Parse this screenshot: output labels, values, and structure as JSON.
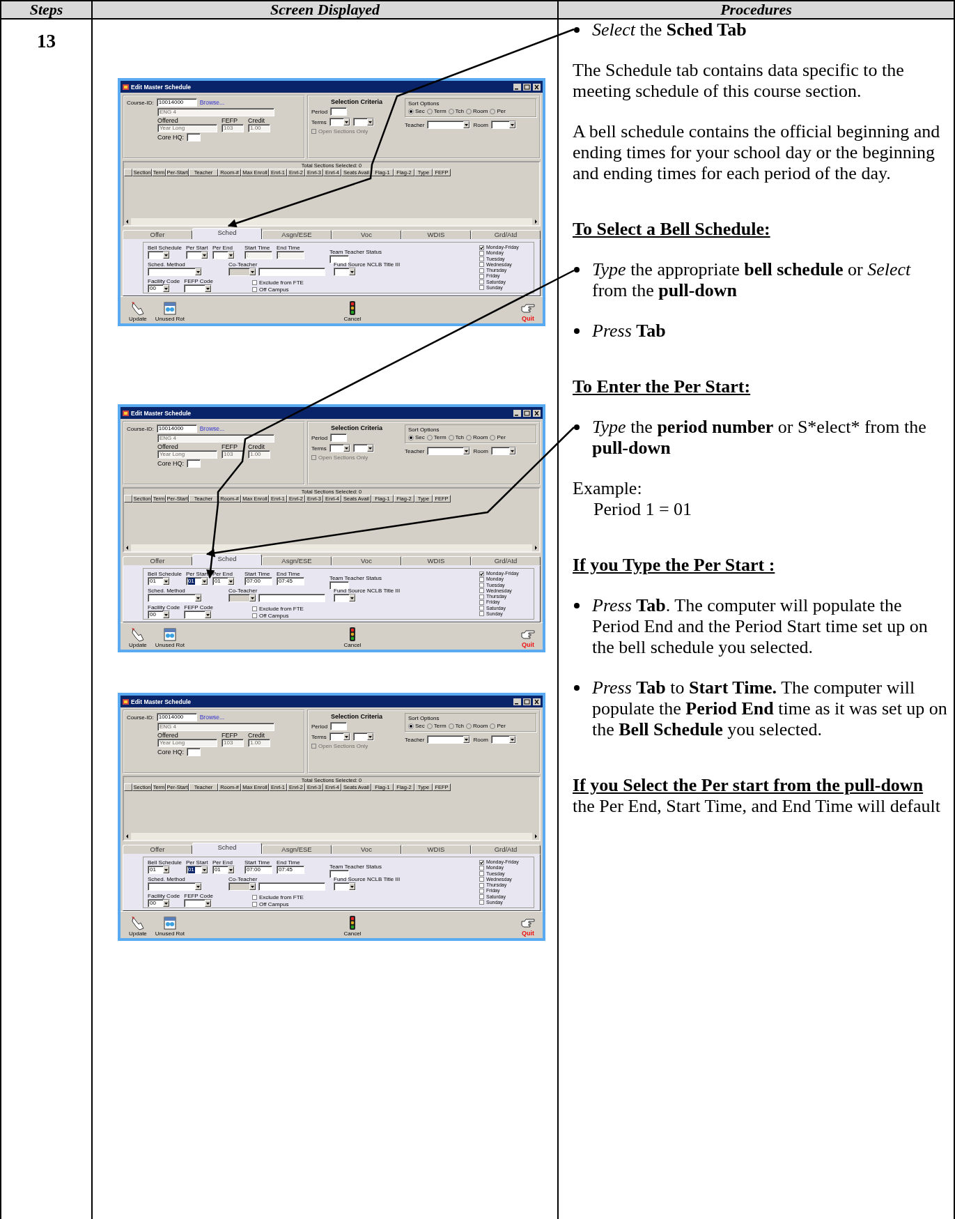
{
  "table": {
    "columns": [
      "Steps",
      "Screen Displayed",
      "Procedures"
    ],
    "step": "13",
    "screens": [
      {
        "title": "Edit Master Schedule",
        "course": {
          "id": {
            "label": "Course-ID:",
            "value": "10014000"
          },
          "browse": "Browse...",
          "name": {
            "value": "ENG 4",
            "disabled": true
          },
          "offered": {
            "label": "Offered",
            "value": "Year Long",
            "disabled": true
          },
          "fefp": {
            "label": "FEFP",
            "value": "103",
            "disabled": true
          },
          "credit": {
            "label": "Credit",
            "value": "1.00",
            "disabled": true
          },
          "core_hq": {
            "label": "Core HQ:"
          }
        },
        "criteria": {
          "title": "Selection Criteria",
          "period_label": "Period",
          "terms_label": "Terms",
          "open_sections": {
            "label": "Open Sections Only",
            "checked": false,
            "disabled": true
          },
          "sort_title": "Sort Options",
          "sort_options": [
            {
              "label": "Sec",
              "selected": true
            },
            {
              "label": "Term",
              "selected": false
            },
            {
              "label": "Tch",
              "selected": false
            },
            {
              "label": "Room",
              "selected": false
            },
            {
              "label": "Per",
              "selected": false
            }
          ],
          "teacher_label": "Teacher",
          "room_label": "Room"
        },
        "grid": {
          "summary": "Total Sections Selected: 0",
          "columns": [
            "Section",
            "Term",
            "Per-Start",
            "Teacher",
            "Room-#",
            "Max Enroll",
            "Enrl-1",
            "Enrl-2",
            "Enrl-3",
            "Enrl-4",
            "Seats Avail",
            "Flag-1",
            "Flag-2",
            "Type",
            "FEFP"
          ]
        },
        "tabs": [
          {
            "label": "Offer",
            "selected": false
          },
          {
            "label": "Sched",
            "selected": true
          },
          {
            "label": "Asgn/ESE",
            "selected": false
          },
          {
            "label": "Voc",
            "selected": false
          },
          {
            "label": "WDIS",
            "selected": false
          },
          {
            "label": "Grd/Atd",
            "selected": false
          }
        ],
        "sched": {
          "bell_schedule": {
            "label": "Bell Schedule"
          },
          "per_start": {
            "label": "Per Start",
            "highlighted": false
          },
          "per_end": {
            "label": "Per End"
          },
          "start_time": {
            "label": "Start Time",
            "value": ":",
            "disabled": true
          },
          "end_time": {
            "label": "End Time",
            "value": ":",
            "disabled": true
          },
          "team_teacher_status": {
            "label": "Team Teacher Status"
          },
          "sched_method": {
            "label": "Sched. Method"
          },
          "co_teacher": {
            "label": "Co-Teacher"
          },
          "fund_source": {
            "label": "Fund Source NCLB Title III"
          },
          "facility_code": {
            "label": "Facility Code",
            "value": "00"
          },
          "fefp_code": {
            "label": "FEFP Code"
          },
          "options": [
            {
              "label": "Exclude from FTE",
              "checked": false
            },
            {
              "label": "Off Campus",
              "checked": false
            }
          ],
          "days": [
            {
              "label": "Monday-Friday",
              "checked": true
            },
            {
              "label": "Monday",
              "checked": false
            },
            {
              "label": "Tuesday",
              "checked": false
            },
            {
              "label": "Wednesday",
              "checked": false
            },
            {
              "label": "Thursday",
              "checked": false
            },
            {
              "label": "Friday",
              "checked": false
            },
            {
              "label": "Saturday",
              "checked": false
            },
            {
              "label": "Sunday",
              "checked": false
            }
          ]
        },
        "toolbar": [
          {
            "kind": "update",
            "label": "Update"
          },
          {
            "kind": "unused_rot",
            "label": "Unused Rot"
          },
          {
            "kind": "cancel",
            "label": "Cancel"
          },
          {
            "kind": "quit",
            "label": "Quit"
          }
        ]
      },
      {
        "title": "Edit Master Schedule",
        "course": {
          "id": {
            "label": "Course-ID:",
            "value": "10014000"
          },
          "browse": "Browse...",
          "name": {
            "value": "ENG 4",
            "disabled": true
          },
          "offered": {
            "label": "Offered",
            "value": "Year Long",
            "disabled": true
          },
          "fefp": {
            "label": "FEFP",
            "value": "103",
            "disabled": true
          },
          "credit": {
            "label": "Credit",
            "value": "1.00",
            "disabled": true
          },
          "core_hq": {
            "label": "Core HQ:"
          }
        },
        "criteria": {
          "title": "Selection Criteria",
          "period_label": "Period",
          "terms_label": "Terms",
          "open_sections": {
            "label": "Open Sections Only",
            "checked": false,
            "disabled": true
          },
          "sort_title": "Sort Options",
          "sort_options": [
            {
              "label": "Sec",
              "selected": true
            },
            {
              "label": "Term",
              "selected": false
            },
            {
              "label": "Tch",
              "selected": false
            },
            {
              "label": "Room",
              "selected": false
            },
            {
              "label": "Per",
              "selected": false
            }
          ],
          "teacher_label": "Teacher",
          "room_label": "Room"
        },
        "grid": {
          "summary": "Total Sections Selected: 0",
          "columns": [
            "Section",
            "Term",
            "Per-Start",
            "Teacher",
            "Room-#",
            "Max Enroll",
            "Enrl-1",
            "Enrl-2",
            "Enrl-3",
            "Enrl-4",
            "Seats Avail",
            "Flag-1",
            "Flag-2",
            "Type",
            "FEFP"
          ]
        },
        "tabs": [
          {
            "label": "Offer",
            "selected": false
          },
          {
            "label": "Sched",
            "selected": true
          },
          {
            "label": "Asgn/ESE",
            "selected": false
          },
          {
            "label": "Voc",
            "selected": false
          },
          {
            "label": "WDIS",
            "selected": false
          },
          {
            "label": "Grd/Atd",
            "selected": false
          }
        ],
        "sched": {
          "bell_schedule": {
            "label": "Bell Schedule",
            "value": "01"
          },
          "per_start": {
            "label": "Per Start",
            "value": "01",
            "highlighted": true
          },
          "per_end": {
            "label": "Per End",
            "value": "01"
          },
          "start_time": {
            "label": "Start Time",
            "value": "07:00",
            "disabled": false
          },
          "end_time": {
            "label": "End Time",
            "value": "07:45",
            "disabled": false
          },
          "team_teacher_status": {
            "label": "Team Teacher Status"
          },
          "sched_method": {
            "label": "Sched. Method"
          },
          "co_teacher": {
            "label": "Co-Teacher"
          },
          "fund_source": {
            "label": "Fund Source NCLB Title III"
          },
          "facility_code": {
            "label": "Facility Code",
            "value": "00"
          },
          "fefp_code": {
            "label": "FEFP Code"
          },
          "options": [
            {
              "label": "Exclude from FTE",
              "checked": false
            },
            {
              "label": "Off Campus",
              "checked": false
            }
          ],
          "days": [
            {
              "label": "Monday-Friday",
              "checked": true
            },
            {
              "label": "Monday",
              "checked": false
            },
            {
              "label": "Tuesday",
              "checked": false
            },
            {
              "label": "Wednesday",
              "checked": false
            },
            {
              "label": "Thursday",
              "checked": false
            },
            {
              "label": "Friday",
              "checked": false
            },
            {
              "label": "Saturday",
              "checked": false
            },
            {
              "label": "Sunday",
              "checked": false
            }
          ]
        },
        "toolbar": [
          {
            "kind": "update",
            "label": "Update"
          },
          {
            "kind": "unused_rot",
            "label": "Unused Rot"
          },
          {
            "kind": "cancel",
            "label": "Cancel"
          },
          {
            "kind": "quit",
            "label": "Quit"
          }
        ]
      },
      {
        "title": "Edit Master Schedule",
        "course": {
          "id": {
            "label": "Course-ID:",
            "value": "10014000"
          },
          "browse": "Browse...",
          "name": {
            "value": "ENG 4",
            "disabled": true
          },
          "offered": {
            "label": "Offered",
            "value": "Year Long",
            "disabled": true
          },
          "fefp": {
            "label": "FEFP",
            "value": "103",
            "disabled": true
          },
          "credit": {
            "label": "Credit",
            "value": "1.00",
            "disabled": true
          },
          "core_hq": {
            "label": "Core HQ:"
          }
        },
        "criteria": {
          "title": "Selection Criteria",
          "period_label": "Period",
          "terms_label": "Terms",
          "open_sections": {
            "label": "Open Sections Only",
            "checked": false,
            "disabled": true
          },
          "sort_title": "Sort Options",
          "sort_options": [
            {
              "label": "Sec",
              "selected": true
            },
            {
              "label": "Term",
              "selected": false
            },
            {
              "label": "Tch",
              "selected": false
            },
            {
              "label": "Room",
              "selected": false
            },
            {
              "label": "Per",
              "selected": false
            }
          ],
          "teacher_label": "Teacher",
          "room_label": "Room"
        },
        "grid": {
          "summary": "Total Sections Selected: 0",
          "columns": [
            "Section",
            "Term",
            "Per-Start",
            "Teacher",
            "Room-#",
            "Max Enroll",
            "Enrl-1",
            "Enrl-2",
            "Enrl-3",
            "Enrl-4",
            "Seats Avail",
            "Flag-1",
            "Flag-2",
            "Type",
            "FEFP"
          ]
        },
        "tabs": [
          {
            "label": "Offer",
            "selected": false
          },
          {
            "label": "Sched",
            "selected": true
          },
          {
            "label": "Asgn/ESE",
            "selected": false
          },
          {
            "label": "Voc",
            "selected": false
          },
          {
            "label": "WDIS",
            "selected": false
          },
          {
            "label": "Grd/Atd",
            "selected": false
          }
        ],
        "sched": {
          "bell_schedule": {
            "label": "Bell Schedule",
            "value": "01"
          },
          "per_start": {
            "label": "Per Start",
            "value": "01",
            "highlighted": true
          },
          "per_end": {
            "label": "Per End",
            "value": "01"
          },
          "start_time": {
            "label": "Start Time",
            "value": "07:00",
            "disabled": false
          },
          "end_time": {
            "label": "End Time",
            "value": "07:45",
            "disabled": false
          },
          "team_teacher_status": {
            "label": "Team Teacher Status"
          },
          "sched_method": {
            "label": "Sched. Method"
          },
          "co_teacher": {
            "label": "Co-Teacher"
          },
          "fund_source": {
            "label": "Fund Source NCLB Title III"
          },
          "facility_code": {
            "label": "Facility Code",
            "value": "00"
          },
          "fefp_code": {
            "label": "FEFP Code"
          },
          "options": [
            {
              "label": "Exclude from FTE",
              "checked": false
            },
            {
              "label": "Off Campus",
              "checked": false
            }
          ],
          "days": [
            {
              "label": "Monday-Friday",
              "checked": true
            },
            {
              "label": "Monday",
              "checked": false
            },
            {
              "label": "Tuesday",
              "checked": false
            },
            {
              "label": "Wednesday",
              "checked": false
            },
            {
              "label": "Thursday",
              "checked": false
            },
            {
              "label": "Friday",
              "checked": false
            },
            {
              "label": "Saturday",
              "checked": false
            },
            {
              "label": "Sunday",
              "checked": false
            }
          ]
        },
        "toolbar": [
          {
            "kind": "update",
            "label": "Update"
          },
          {
            "kind": "unused_rot",
            "label": "Unused Rot"
          },
          {
            "kind": "cancel",
            "label": "Cancel"
          },
          {
            "kind": "quit",
            "label": "Quit"
          }
        ]
      }
    ],
    "procedures": [
      {
        "kind": "bullet",
        "text": "*Select* the **Sched Tab**"
      },
      {
        "kind": "paragraph",
        "text": "The Schedule tab contains data specific to the meeting schedule of this course section."
      },
      {
        "kind": "paragraph",
        "text": "A bell schedule contains the official beginning and ending times for your school day or the beginning and ending times for each period of the day."
      },
      {
        "kind": "heading",
        "text": "To Select a Bell Schedule:"
      },
      {
        "kind": "bullet",
        "text": "*Type* the appropriate **bell schedule** or *Select* from the **pull-down**"
      },
      {
        "kind": "bullet",
        "text": "*Press* **Tab**"
      },
      {
        "kind": "heading",
        "text": "To Enter the Per Start:"
      },
      {
        "kind": "bullet",
        "text": "*Type* the **period number** or S*elect* from the **pull-down**"
      },
      {
        "kind": "example",
        "text": "Example:",
        "value": "Period 1 = 01"
      },
      {
        "kind": "heading",
        "text": "If you Type the Per Start :"
      },
      {
        "kind": "bullet",
        "text": "*Press* **Tab**. The computer will populate the Period End and the Period Start time set up on the bell schedule you selected."
      },
      {
        "kind": "bullet",
        "text": "*Press* **Tab** to **Start Time.** The computer will populate the **Period End** time as it was set up on the **Bell Schedule** you selected."
      },
      {
        "kind": "lead",
        "text": "**If you Select the Per start from the pull-down** the Per End, Start Time, and End Time will default"
      }
    ]
  }
}
